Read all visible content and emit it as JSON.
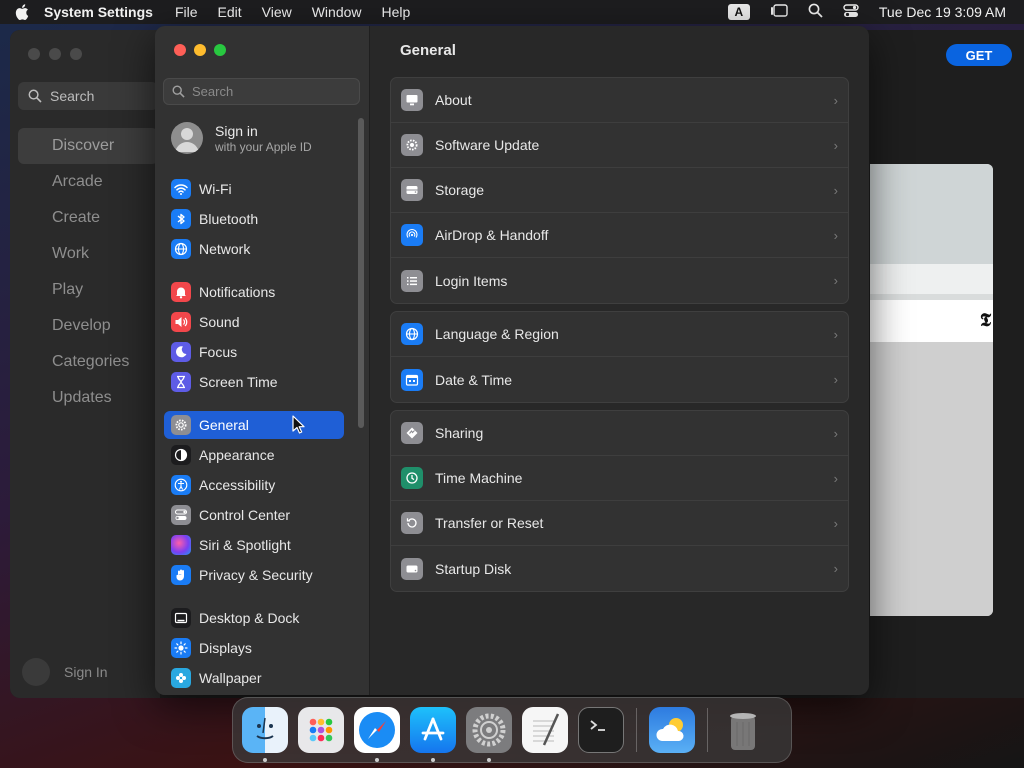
{
  "menubar": {
    "app_name": "System Settings",
    "menus": [
      "File",
      "Edit",
      "View",
      "Window",
      "Help"
    ],
    "input_badge": "A",
    "clock": "Tue Dec 19  3:09 AM"
  },
  "appstore": {
    "search_label": "Search",
    "nav": [
      "Discover",
      "Arcade",
      "Create",
      "Work",
      "Play",
      "Develop",
      "Categories",
      "Updates"
    ],
    "active_nav": "Discover",
    "signin_label": "Sign In",
    "get_label": "GET"
  },
  "settings": {
    "search_placeholder": "Search",
    "apple_id": {
      "title": "Sign in",
      "subtitle": "with your Apple ID"
    },
    "sidebar": [
      {
        "label": "Wi-Fi",
        "icon": "wifi-icon",
        "color": "#1a7cf5"
      },
      {
        "label": "Bluetooth",
        "icon": "bluetooth-icon",
        "color": "#1a7cf5"
      },
      {
        "label": "Network",
        "icon": "globe-icon",
        "color": "#1a7cf5"
      },
      {
        "label": "Notifications",
        "icon": "bell-icon",
        "color": "#f2474b"
      },
      {
        "label": "Sound",
        "icon": "speaker-icon",
        "color": "#f2474b"
      },
      {
        "label": "Focus",
        "icon": "moon-icon",
        "color": "#5e5ce6"
      },
      {
        "label": "Screen Time",
        "icon": "hourglass-icon",
        "color": "#5e5ce6"
      },
      {
        "label": "General",
        "icon": "gear-icon",
        "color": "#8e8e93"
      },
      {
        "label": "Appearance",
        "icon": "appearance-icon",
        "color": "#1c1c1e"
      },
      {
        "label": "Accessibility",
        "icon": "accessibility-icon",
        "color": "#1a7cf5"
      },
      {
        "label": "Control Center",
        "icon": "control-center-icon",
        "color": "#8e8e93"
      },
      {
        "label": "Siri & Spotlight",
        "icon": "siri-icon",
        "color": "#b44ad8"
      },
      {
        "label": "Privacy & Security",
        "icon": "hand-icon",
        "color": "#1a7cf5"
      },
      {
        "label": "Desktop & Dock",
        "icon": "dock-icon",
        "color": "#1c1c1e"
      },
      {
        "label": "Displays",
        "icon": "sun-icon",
        "color": "#1a7cf5"
      },
      {
        "label": "Wallpaper",
        "icon": "wallpaper-icon",
        "color": "#29a8e0"
      }
    ],
    "active_item": "General",
    "content_title": "General",
    "groups": [
      [
        {
          "label": "About",
          "icon": "display-icon"
        },
        {
          "label": "Software Update",
          "icon": "gear-badge-icon"
        },
        {
          "label": "Storage",
          "icon": "drive-icon"
        },
        {
          "label": "AirDrop & Handoff",
          "icon": "airdrop-icon"
        },
        {
          "label": "Login Items",
          "icon": "list-icon"
        }
      ],
      [
        {
          "label": "Language & Region",
          "icon": "globe-icon"
        },
        {
          "label": "Date & Time",
          "icon": "calendar-icon"
        }
      ],
      [
        {
          "label": "Sharing",
          "icon": "sharing-icon"
        },
        {
          "label": "Time Machine",
          "icon": "time-machine-icon"
        },
        {
          "label": "Transfer or Reset",
          "icon": "reset-icon"
        },
        {
          "label": "Startup Disk",
          "icon": "disk-icon"
        }
      ]
    ]
  },
  "dock": [
    {
      "name": "finder",
      "running": true
    },
    {
      "name": "launchpad",
      "running": false
    },
    {
      "name": "safari",
      "running": true
    },
    {
      "name": "app-store",
      "running": true
    },
    {
      "name": "system-settings",
      "running": true
    },
    {
      "name": "textedit",
      "running": false
    },
    {
      "name": "terminal",
      "running": false
    },
    {
      "name": "weather",
      "running": false
    },
    {
      "name": "trash",
      "running": false
    }
  ]
}
